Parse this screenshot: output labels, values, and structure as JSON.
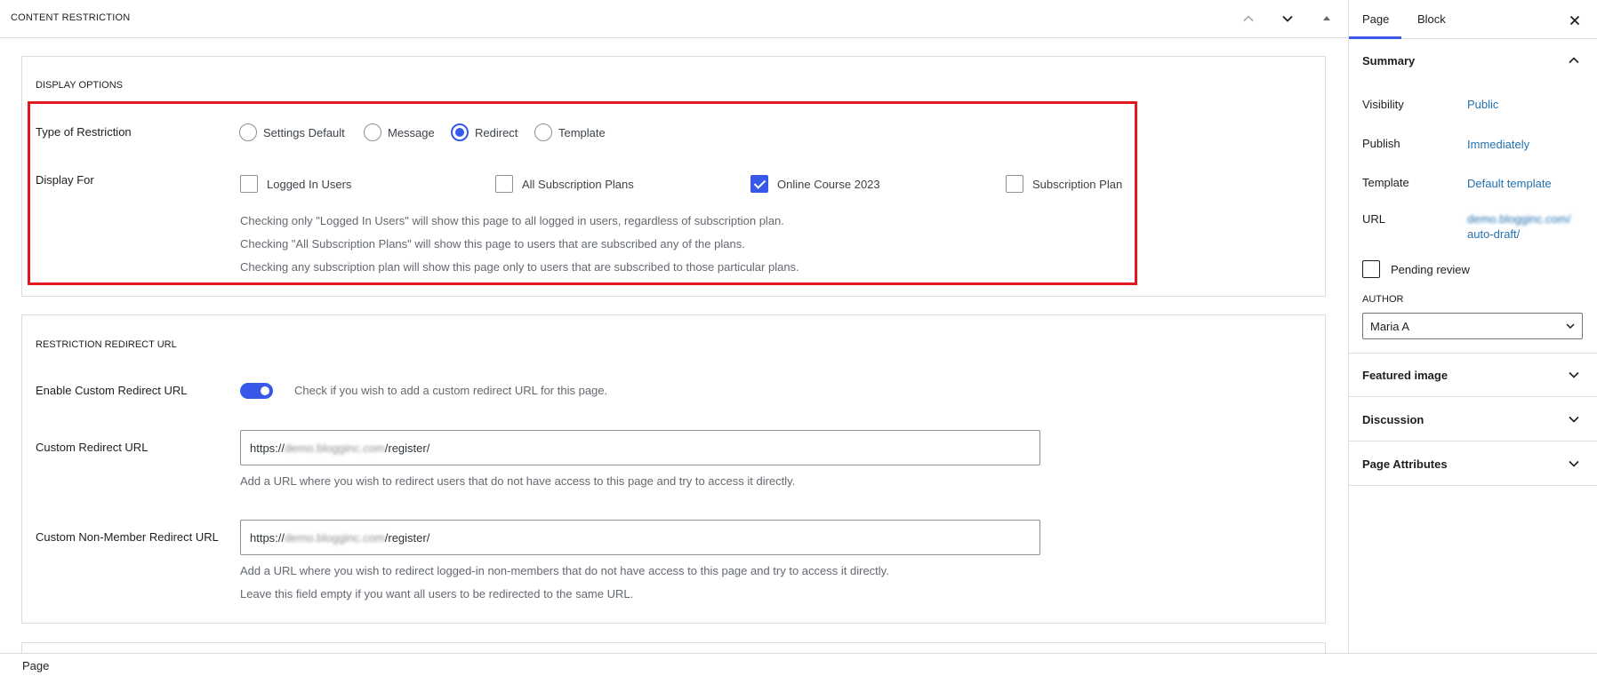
{
  "metabox": {
    "title": "CONTENT RESTRICTION"
  },
  "display_options": {
    "title": "DISPLAY OPTIONS",
    "restriction_type_label": "Type of Restriction",
    "restriction_types": [
      {
        "label": "Settings Default",
        "selected": false
      },
      {
        "label": "Message",
        "selected": false
      },
      {
        "label": "Redirect",
        "selected": true
      },
      {
        "label": "Template",
        "selected": false
      }
    ],
    "display_for_label": "Display For",
    "display_for": [
      {
        "label": "Logged In Users",
        "checked": false
      },
      {
        "label": "All Subscription Plans",
        "checked": false
      },
      {
        "label": "Online Course 2023",
        "checked": true
      },
      {
        "label": "Subscription Plan",
        "checked": false
      }
    ],
    "help": [
      "Checking only \"Logged In Users\" will show this page to all logged in users, regardless of subscription plan.",
      "Checking \"All Subscription Plans\" will show this page to users that are subscribed any of the plans.",
      "Checking any subscription plan will show this page only to users that are subscribed to those particular plans."
    ]
  },
  "redirect": {
    "title": "RESTRICTION REDIRECT URL",
    "enable_label": "Enable Custom Redirect URL",
    "enable_on": true,
    "enable_help": "Check if you wish to add a custom redirect URL for this page.",
    "custom_url_label": "Custom Redirect URL",
    "custom_url_prefix": "https://",
    "custom_url_domain": "demo.blogginc.com",
    "custom_url_path": "/register/",
    "custom_url_help": "Add a URL where you wish to redirect users that do not have access to this page and try to access it directly.",
    "nonmember_label": "Custom Non-Member Redirect URL",
    "nonmember_prefix": "https://",
    "nonmember_domain": "demo.blogginc.com",
    "nonmember_path": "/register/",
    "nonmember_help_1": "Add a URL where you wish to redirect logged-in non-members that do not have access to this page and try to access it directly.",
    "nonmember_help_2": "Leave this field empty if you want all users to be redirected to the same URL."
  },
  "footer": {
    "breadcrumb": "Page"
  },
  "sidebar": {
    "tabs": [
      "Page",
      "Block"
    ],
    "active_tab": "Page",
    "summary": {
      "title": "Summary",
      "visibility_label": "Visibility",
      "visibility_value": "Public",
      "publish_label": "Publish",
      "publish_value": "Immediately",
      "template_label": "Template",
      "template_value": "Default template",
      "url_label": "URL",
      "url_domain": "demo.blogginc.com/",
      "url_path": "auto-draft/",
      "pending_label": "Pending review",
      "author_label": "AUTHOR",
      "author_value": "Maria A"
    },
    "sections": [
      "Featured image",
      "Discussion",
      "Page Attributes"
    ]
  },
  "colors": {
    "accent": "#3858e9",
    "link": "#2271b1",
    "highlight_border": "#e1181e"
  }
}
